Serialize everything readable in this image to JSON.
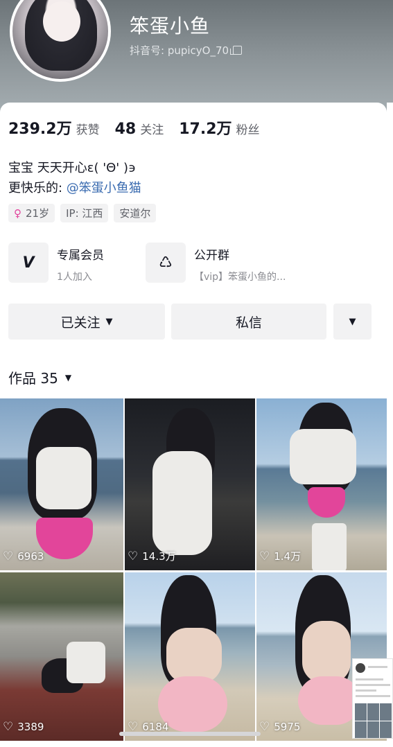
{
  "profile": {
    "nickname": "笨蛋小鱼",
    "douyin_id_label": "抖音号: pupicyO_70",
    "avatar_icon": "avatar-image"
  },
  "stats": {
    "likes_value": "239.2万",
    "likes_label": "获赞",
    "following_value": "48",
    "following_label": "关注",
    "followers_value": "17.2万",
    "followers_label": "粉丝"
  },
  "bio": {
    "line1": "宝宝 天天开心ε( 'Θ' )϶",
    "line2_prefix": "更快乐的: ",
    "line2_mention": "@笨蛋小鱼猫"
  },
  "tags": {
    "age": "21岁",
    "ip": "IP: 江西",
    "location": "安道尔",
    "gender_icon": "♀"
  },
  "features": [
    {
      "icon": "V",
      "title": "专属会员",
      "subtitle": "1人加入"
    },
    {
      "icon": "♺",
      "title": "公开群",
      "subtitle": "【vip】笨蛋小鱼的..."
    }
  ],
  "actions": {
    "follow_label": "已关注",
    "message_label": "私信",
    "caret": "▼"
  },
  "works": {
    "label": "作品 35",
    "caret": "▼"
  },
  "videos": [
    {
      "likes": "6963"
    },
    {
      "likes": "14.3万"
    },
    {
      "likes": "1.4万"
    },
    {
      "likes": "3389"
    },
    {
      "likes": "6184"
    },
    {
      "likes": "5975"
    }
  ],
  "icons": {
    "heart": "♡",
    "copy": "copy-icon"
  },
  "colors": {
    "mention": "#3a6bb0",
    "gender": "#e2449c",
    "button_bg": "#f2f2f3"
  }
}
